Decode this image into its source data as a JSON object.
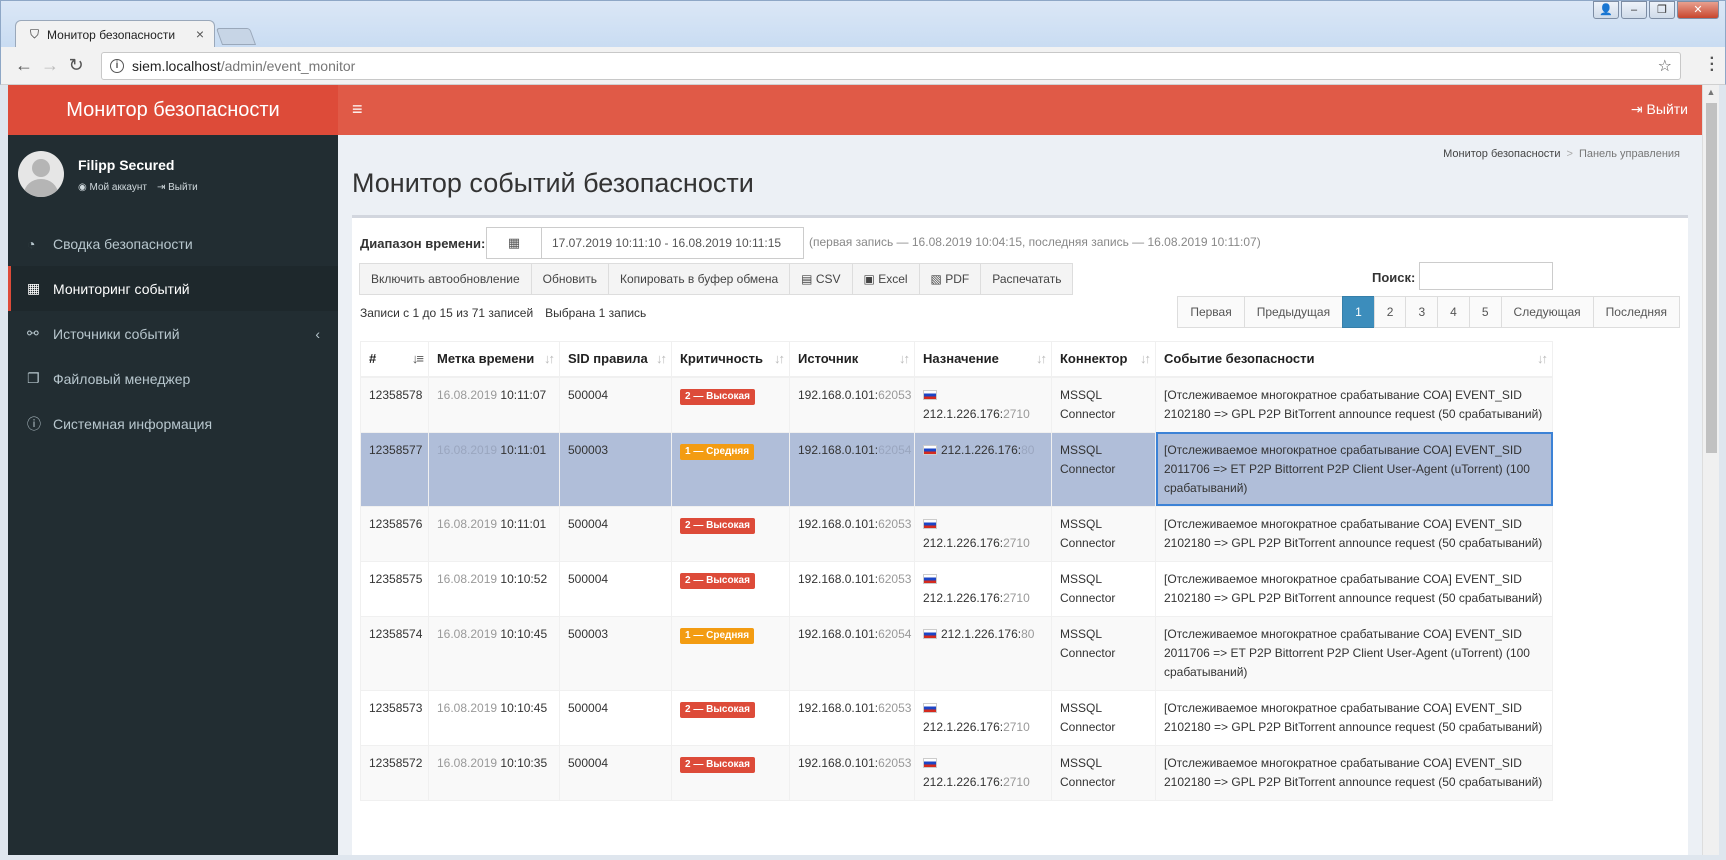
{
  "browser": {
    "tab_title": "Монитор безопасности",
    "url_host": "siem.localhost",
    "url_path": "/admin/event_monitor"
  },
  "app": {
    "logo": "Монитор безопасности",
    "logout": "Выйти",
    "accent": "#dd4b39"
  },
  "user": {
    "name": "Filipp Secured",
    "account_link": "Мой аккаунт",
    "logout_link": "Выйти"
  },
  "sidebar": {
    "items": [
      {
        "label": "Сводка безопасности",
        "icon": "dashboard-icon"
      },
      {
        "label": "Мониторинг событий",
        "icon": "table-icon"
      },
      {
        "label": "Источники событий",
        "icon": "link-icon"
      },
      {
        "label": "Файловый менеджер",
        "icon": "files-icon"
      },
      {
        "label": "Системная информация",
        "icon": "info-icon"
      }
    ]
  },
  "breadcrumb": {
    "home": "Монитор безопасности",
    "current": "Панель управления"
  },
  "page": {
    "title": "Монитор событий безопасности",
    "range_label": "Диапазон времени:",
    "range_value": "17.07.2019 10:11:10 - 16.08.2019 10:11:15",
    "range_note": "(первая запись — 16.08.2019 10:04:15, последняя запись — 16.08.2019 10:11:07)",
    "search_label": "Поиск:",
    "search_value": "",
    "records_info": "Записи с 1 до 15 из 71 записей",
    "selected_info": "Выбрана 1 запись"
  },
  "buttons": {
    "autorefresh": "Включить автообновление",
    "refresh": "Обновить",
    "copy": "Копировать в буфер обмена",
    "csv": "CSV",
    "excel": "Excel",
    "pdf": "PDF",
    "print": "Распечатать"
  },
  "pager": {
    "first": "Первая",
    "prev": "Предыдущая",
    "pages": [
      "1",
      "2",
      "3",
      "4",
      "5"
    ],
    "next": "Следующая",
    "last": "Последняя"
  },
  "table": {
    "headers": [
      "#",
      "Метка времени",
      "SID правила",
      "Критичность",
      "Источник",
      "Назначение",
      "Коннектор",
      "Событие безопасности"
    ],
    "rows": [
      {
        "id": "12358578",
        "date": "16.08.2019",
        "time": "10:11:07",
        "sid": "500004",
        "sev": "2 — Высокая",
        "sev_class": "high",
        "src_ip": "192.168.0.101:",
        "src_port": "62053",
        "dst_ip": "212.1.226.176:",
        "dst_port": "2710",
        "conn": "MSSQL Connector",
        "event": "[Отслеживаемое многократное срабатывание СОА] EVENT_SID 2102180 => GPL P2P BitTorrent announce request (50 срабатываний)"
      },
      {
        "id": "12358577",
        "date": "16.08.2019",
        "time": "10:11:01",
        "sid": "500003",
        "sev": "1 — Средняя",
        "sev_class": "mid",
        "src_ip": "192.168.0.101:",
        "src_port": "62054",
        "dst_ip": "212.1.226.176:",
        "dst_port": "80",
        "conn": "MSSQL Connector",
        "event": "[Отслеживаемое многократное срабатывание СОА] EVENT_SID 2011706 => ET P2P Bittorrent P2P Client User-Agent (uTorrent) (100 срабатываний)"
      },
      {
        "id": "12358576",
        "date": "16.08.2019",
        "time": "10:11:01",
        "sid": "500004",
        "sev": "2 — Высокая",
        "sev_class": "high",
        "src_ip": "192.168.0.101:",
        "src_port": "62053",
        "dst_ip": "212.1.226.176:",
        "dst_port": "2710",
        "conn": "MSSQL Connector",
        "event": "[Отслеживаемое многократное срабатывание СОА] EVENT_SID 2102180 => GPL P2P BitTorrent announce request (50 срабатываний)"
      },
      {
        "id": "12358575",
        "date": "16.08.2019",
        "time": "10:10:52",
        "sid": "500004",
        "sev": "2 — Высокая",
        "sev_class": "high",
        "src_ip": "192.168.0.101:",
        "src_port": "62053",
        "dst_ip": "212.1.226.176:",
        "dst_port": "2710",
        "conn": "MSSQL Connector",
        "event": "[Отслеживаемое многократное срабатывание СОА] EVENT_SID 2102180 => GPL P2P BitTorrent announce request (50 срабатываний)"
      },
      {
        "id": "12358574",
        "date": "16.08.2019",
        "time": "10:10:45",
        "sid": "500003",
        "sev": "1 — Средняя",
        "sev_class": "mid",
        "src_ip": "192.168.0.101:",
        "src_port": "62054",
        "dst_ip": "212.1.226.176:",
        "dst_port": "80",
        "conn": "MSSQL Connector",
        "event": "[Отслеживаемое многократное срабатывание СОА] EVENT_SID 2011706 => ET P2P Bittorrent P2P Client User-Agent (uTorrent) (100 срабатываний)"
      },
      {
        "id": "12358573",
        "date": "16.08.2019",
        "time": "10:10:45",
        "sid": "500004",
        "sev": "2 — Высокая",
        "sev_class": "high",
        "src_ip": "192.168.0.101:",
        "src_port": "62053",
        "dst_ip": "212.1.226.176:",
        "dst_port": "2710",
        "conn": "MSSQL Connector",
        "event": "[Отслеживаемое многократное срабатывание СОА] EVENT_SID 2102180 => GPL P2P BitTorrent announce request (50 срабатываний)"
      },
      {
        "id": "12358572",
        "date": "16.08.2019",
        "time": "10:10:35",
        "sid": "500004",
        "sev": "2 — Высокая",
        "sev_class": "high",
        "src_ip": "192.168.0.101:",
        "src_port": "62053",
        "dst_ip": "212.1.226.176:",
        "dst_port": "2710",
        "conn": "MSSQL Connector",
        "event": "[Отслеживаемое многократное срабатывание СОА] EVENT_SID 2102180 => GPL P2P BitTorrent announce request (50 срабатываний)"
      }
    ],
    "selected_index": 1
  }
}
